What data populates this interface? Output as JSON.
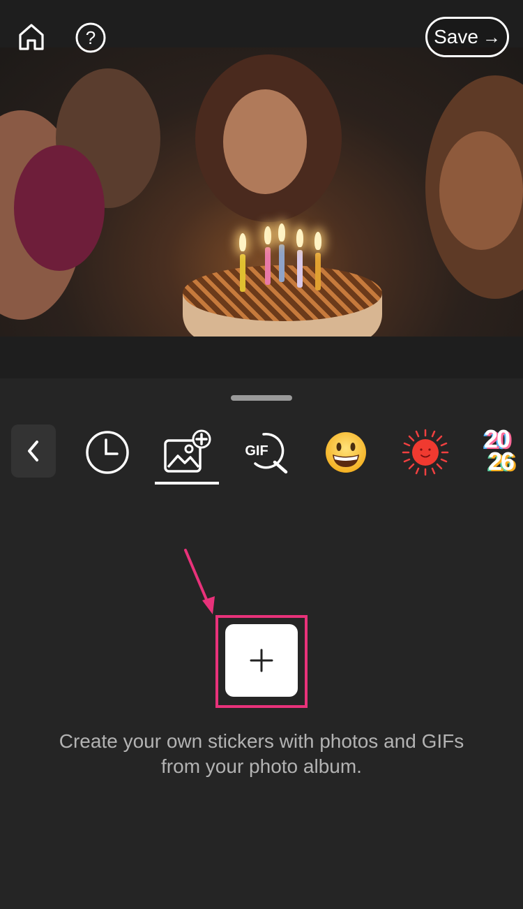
{
  "topbar": {
    "home_icon": "home-icon",
    "help_icon": "help-icon",
    "save_label": "Save",
    "save_arrow": "→"
  },
  "sticker_tabs": {
    "back_icon": "chevron-left-icon",
    "items": [
      {
        "icon": "recent-clock-icon",
        "selected": false
      },
      {
        "icon": "add-photo-icon",
        "selected": true
      },
      {
        "icon": "gif-search-icon",
        "label": "GIF",
        "selected": false
      },
      {
        "icon": "grinning-emoji-icon",
        "selected": false
      },
      {
        "icon": "sun-sticker-icon",
        "selected": false
      },
      {
        "icon": "year-2026-sticker-icon",
        "label": "2026",
        "selected": false
      }
    ]
  },
  "content": {
    "add_label": "+",
    "hint": "Create your own stickers with photos and GIFs from your photo album."
  },
  "colors": {
    "highlight": "#e8327a",
    "background": "#252525"
  }
}
